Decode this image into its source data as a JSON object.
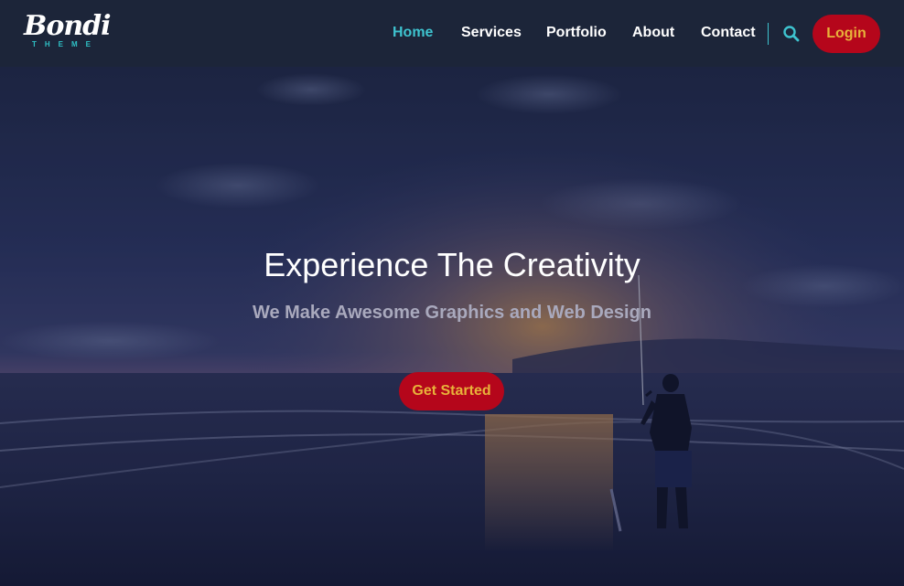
{
  "brand": {
    "name": "Bondi",
    "tagline": "THEME",
    "accent": "#2fc1c6"
  },
  "nav": {
    "items": [
      {
        "label": "Home",
        "active": true
      },
      {
        "label": "Services",
        "active": false
      },
      {
        "label": "Portfolio",
        "active": false
      },
      {
        "label": "About",
        "active": false
      },
      {
        "label": "Contact",
        "active": false
      }
    ],
    "search_icon": "search-icon",
    "login_label": "Login"
  },
  "hero": {
    "title": "Experience The Creativity",
    "subtitle": "We Make Awesome Graphics and Web Design",
    "cta_label": "Get Started"
  },
  "colors": {
    "header_bg": "#1c2539",
    "nav_active": "#3ec3cf",
    "button_bg": "#b5061b",
    "button_text": "#e8b23a"
  }
}
